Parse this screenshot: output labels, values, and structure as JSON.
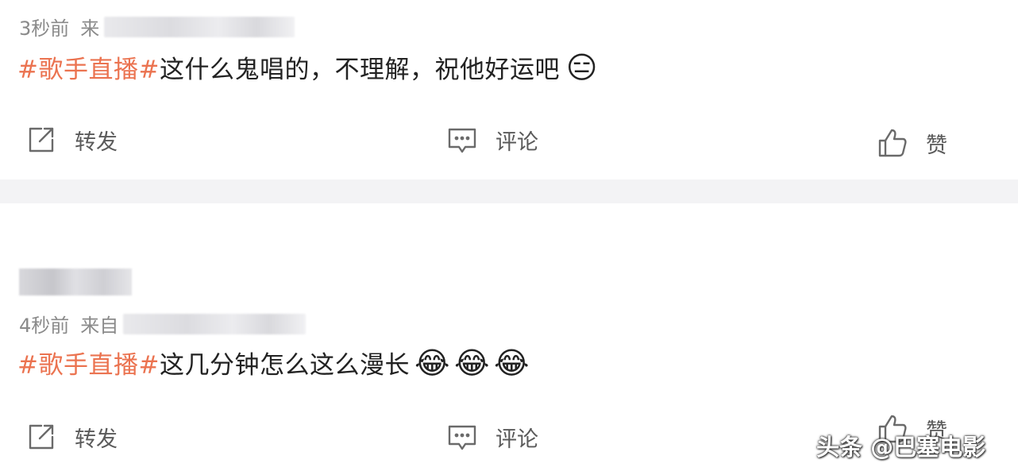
{
  "posts": [
    {
      "time": "3秒前",
      "source_label": "来",
      "hashtag": "#歌手直播#",
      "text": "这什么鬼唱的，不理解，祝他好运吧",
      "emojis": [
        "😑"
      ],
      "actions": {
        "forward": "转发",
        "comment": "评论",
        "like": "赞"
      }
    },
    {
      "time": "4秒前",
      "source_label": "来自",
      "hashtag": "#歌手直播#",
      "text": "这几分钟怎么这么漫长",
      "emojis": [
        "😂",
        "😂",
        "😂"
      ],
      "actions": {
        "forward": "转发",
        "comment": "评论",
        "like": "赞"
      }
    }
  ],
  "watermark": "头条 @巴塞电影",
  "icons": {
    "forward": "share-icon",
    "comment": "comment-icon",
    "like": "thumbs-up-icon"
  },
  "colors": {
    "hashtag": "#eb7350",
    "meta": "#8a8a8a",
    "separator": "#f3f3f5"
  }
}
